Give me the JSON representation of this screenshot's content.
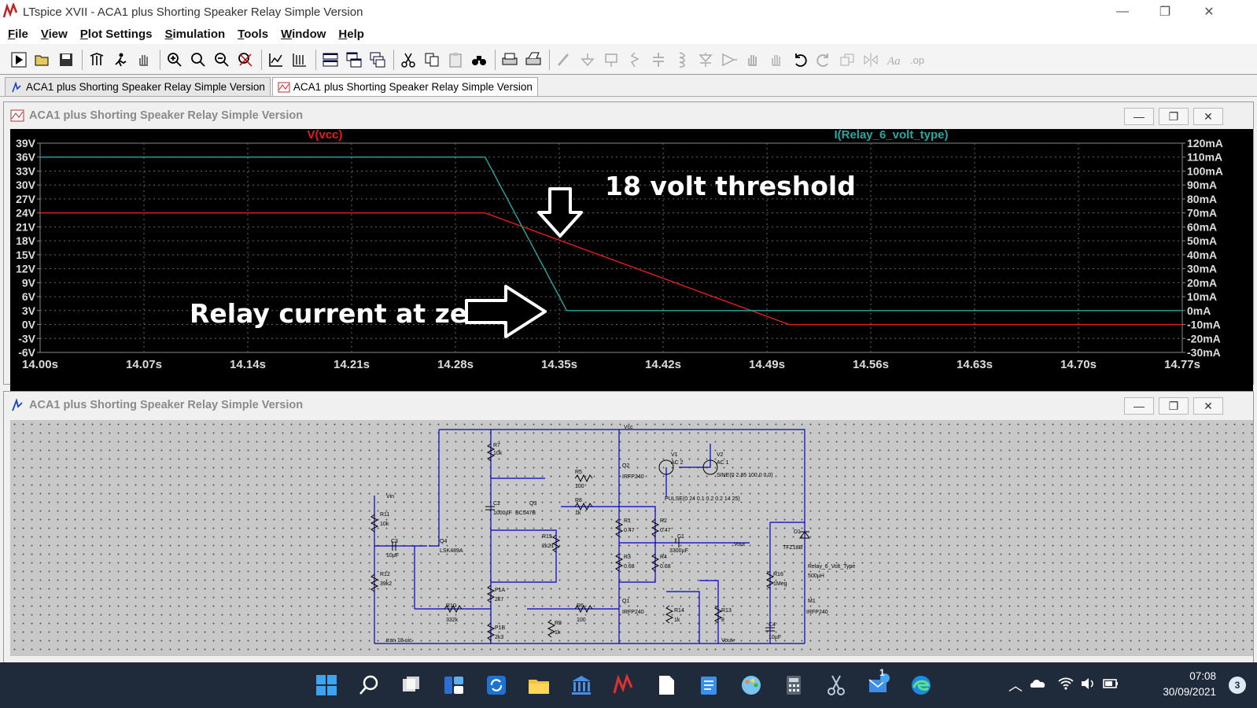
{
  "window": {
    "title": "LTspice XVII - ACA1 plus Shorting Speaker Relay Simple Version",
    "minimize": "—",
    "maximize": "❐",
    "close": "✕"
  },
  "menu": [
    "File",
    "View",
    "Plot Settings",
    "Simulation",
    "Tools",
    "Window",
    "Help"
  ],
  "toolbar_icons": [
    "run-icon",
    "open-icon",
    "save-icon",
    "control-panel-icon",
    "run-stop-icon",
    "pan-icon",
    "zoom-in-icon",
    "zoom-area-icon",
    "zoom-out-icon",
    "zoom-fit-icon",
    "autorange-icon",
    "measure-icon",
    "tile-horizontal-icon",
    "tile-vertical-icon",
    "cascade-icon",
    "cut-icon",
    "copy-icon",
    "paste-icon",
    "find-icon",
    "print-icon",
    "print-setup-icon",
    "wire-icon",
    "ground-icon",
    "label-icon",
    "resistor-icon",
    "capacitor-icon",
    "inductor-icon",
    "diode-icon",
    "component-icon",
    "move-icon",
    "drag-icon",
    "undo-icon",
    "redo-icon",
    "rotate-icon",
    "mirror-icon",
    "text-icon",
    "spice-directive-icon"
  ],
  "tabs": [
    {
      "label": "ACA1 plus Shorting Speaker Relay Simple Version",
      "kind": "schematic"
    },
    {
      "label": "ACA1 plus Shorting Speaker Relay Simple Version",
      "kind": "waveform"
    }
  ],
  "plot_window": {
    "title": "ACA1 plus Shorting Speaker Relay Simple Version",
    "buttons": {
      "minimize": "—",
      "restore": "❐",
      "close": "✕"
    }
  },
  "schematic_window": {
    "title": "ACA1 plus Shorting Speaker Relay Simple Version",
    "buttons": {
      "minimize": "—",
      "restore": "❐",
      "close": "✕"
    }
  },
  "chart_data": {
    "type": "line",
    "background": "#000000",
    "grid": true,
    "xlim": [
      14.0,
      14.77
    ],
    "x_ticks": [
      "14.00s",
      "14.07s",
      "14.14s",
      "14.21s",
      "14.28s",
      "14.35s",
      "14.42s",
      "14.49s",
      "14.56s",
      "14.63s",
      "14.70s",
      "14.77s"
    ],
    "y_left": {
      "ticks": [
        "39V",
        "36V",
        "33V",
        "30V",
        "27V",
        "24V",
        "21V",
        "18V",
        "15V",
        "12V",
        "9V",
        "6V",
        "3V",
        "0V",
        "-3V",
        "-6V"
      ],
      "lim": [
        -6,
        39
      ]
    },
    "y_right": {
      "ticks": [
        "120mA",
        "110mA",
        "100mA",
        "90mA",
        "80mA",
        "70mA",
        "60mA",
        "50mA",
        "40mA",
        "30mA",
        "20mA",
        "10mA",
        "0mA",
        "-10mA",
        "-20mA",
        "-30mA"
      ],
      "lim": [
        -30,
        120
      ]
    },
    "series": [
      {
        "name": "V(vcc)",
        "color": "#e02020",
        "axis": "left",
        "x": [
          14.0,
          14.3,
          14.505,
          14.77
        ],
        "y": [
          24,
          24,
          0,
          0
        ]
      },
      {
        "name": "I(Relay_6_volt_type)",
        "color": "#2aa7a0",
        "axis": "right",
        "x": [
          14.0,
          14.3,
          14.355,
          14.77
        ],
        "y": [
          110,
          110,
          0,
          0
        ]
      }
    ],
    "annotations": [
      {
        "text": "18 volt threshold",
        "arrow": "down"
      },
      {
        "text": "Relay current at zero",
        "arrow": "right"
      }
    ]
  },
  "schematic": {
    "labels": [
      "Vcc",
      "Vin",
      "R7",
      "10k",
      "R5",
      "100",
      "Q2",
      "IRFP240",
      "V1",
      "AC 2",
      "V2",
      "AC 1",
      "SINE(0 2.85 100 0 0 0)",
      "PULSE(0 24 0.1 0.2 0.2 14 25)",
      "C2",
      "1000µF",
      "Q3",
      "BC547B",
      "R8",
      "1k",
      "R1",
      "0.47",
      "R2",
      "0.47",
      "C1",
      "3300µF",
      "Vout",
      "R11",
      "10k",
      "C3",
      "10µF",
      "Q4",
      "LSK489A",
      "R15",
      "2k21",
      "R3",
      "0.68",
      "R4",
      "0.68",
      "D1",
      "TFZ18B",
      "Relay_6_Volt_Type",
      "500µH",
      "R16",
      "1Meg",
      "R12",
      "39k2",
      "P1A",
      "2k7",
      "R10",
      "332k",
      "R6",
      "100",
      "Q1",
      "IRFP240",
      "R14",
      "1k",
      "R13",
      "8",
      "M1",
      "IRFP240",
      "R9",
      "1k",
      "P1B",
      "2k3",
      "C4",
      "10µF",
      "Vout+",
      ".tran 18 uic"
    ]
  },
  "taskbar": {
    "icons": [
      "windows-start-icon",
      "search-icon",
      "task-view-icon",
      "widgets-icon",
      "sync-icon",
      "file-explorer-icon",
      "bank-icon",
      "ltspice-icon",
      "document-icon",
      "notepad-icon",
      "paint-icon",
      "calculator-icon",
      "snipping-tool-icon",
      "mail-icon",
      "edge-icon"
    ],
    "mail_badge": "1",
    "time": "07:08",
    "date": "30/09/2021",
    "notifications": "3"
  }
}
